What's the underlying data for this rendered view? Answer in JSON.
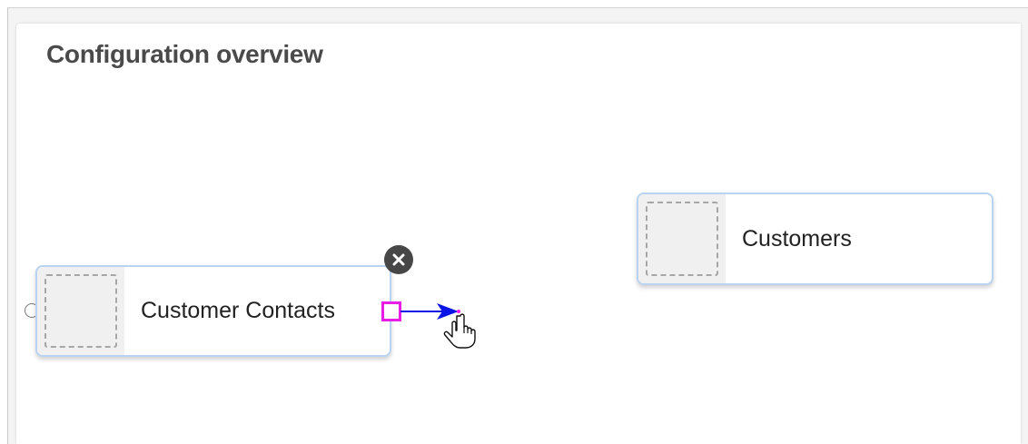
{
  "panel": {
    "title": "Configuration overview"
  },
  "entities": [
    {
      "label": "Customer Contacts"
    },
    {
      "label": "Customers"
    }
  ],
  "colors": {
    "card_border": "#b8d4f2",
    "output_port": "#e81ee8",
    "link_arrow": "#0a14e6",
    "delete_button": "#474747"
  },
  "icons": {
    "delete": "close-icon",
    "cursor": "hand-pointer-icon",
    "link": "arrow-right-icon"
  }
}
